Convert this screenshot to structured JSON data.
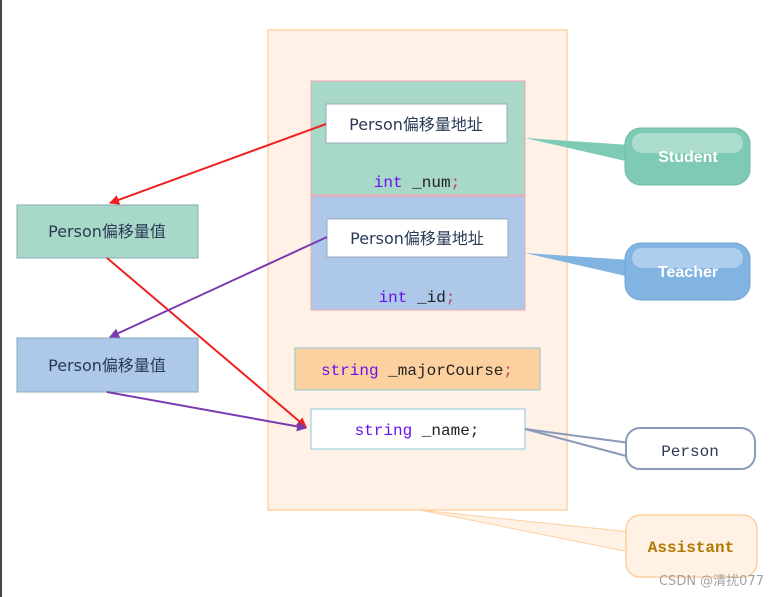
{
  "labels": {
    "offset_address_1": "Person偏移量地址",
    "offset_address_2": "Person偏移量地址",
    "offset_value_1": "Person偏移量值",
    "offset_value_2": "Person偏移量值",
    "num_type": "int",
    "num_name": " _num",
    "id_type": "int",
    "id_name": " _id",
    "major_type": "string",
    "major_name": " _majorCourse",
    "name_type": "string",
    "name_name": " _name",
    "semicolon": ";"
  },
  "callouts": {
    "student": "Student",
    "teacher": "Teacher",
    "person": "Person",
    "assistant": "Assistant"
  },
  "watermark": "CSDN @清扰077",
  "colors": {
    "student": "#7ecab4",
    "teacher": "#82b4e2",
    "assistant_bg": "#fff1e4",
    "keyword": "#6a10f0",
    "arrow_red": "#f02020",
    "arrow_purple": "#7a3ab0"
  }
}
